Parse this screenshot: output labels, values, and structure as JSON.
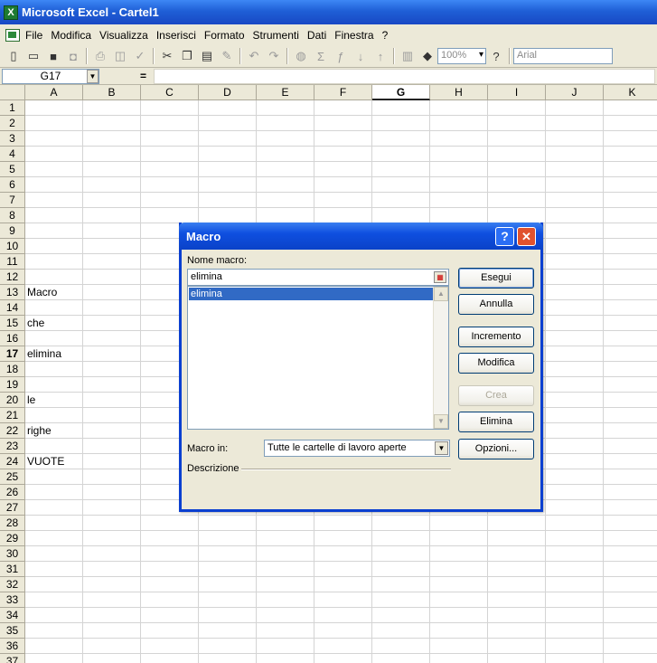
{
  "window": {
    "title": "Microsoft Excel - Cartel1"
  },
  "menu": [
    "File",
    "Modifica",
    "Visualizza",
    "Inserisci",
    "Formato",
    "Strumenti",
    "Dati",
    "Finestra",
    "?"
  ],
  "toolbar": {
    "zoom": "100%",
    "font": "Arial"
  },
  "formula_bar": {
    "name_box": "G17",
    "eq": "="
  },
  "columns": [
    "A",
    "B",
    "C",
    "D",
    "E",
    "F",
    "G",
    "H",
    "I",
    "J",
    "K"
  ],
  "selected_column": "G",
  "selected_row": "17",
  "rows": [
    "1",
    "2",
    "3",
    "4",
    "5",
    "6",
    "7",
    "8",
    "9",
    "10",
    "11",
    "12",
    "13",
    "14",
    "15",
    "16",
    "17",
    "18",
    "19",
    "20",
    "21",
    "22",
    "23",
    "24",
    "25",
    "26",
    "27",
    "28",
    "29",
    "30",
    "31",
    "32",
    "33",
    "34",
    "35",
    "36",
    "37"
  ],
  "cells": {
    "a13": "Macro",
    "a15": "che",
    "a17": "elimina",
    "a20": "le",
    "a22": "righe",
    "a24": "VUOTE"
  },
  "dialog": {
    "title": "Macro",
    "help": "?",
    "close": "✕",
    "name_label": "Nome macro:",
    "name_value": "elimina",
    "list": [
      "elimina"
    ],
    "buttons": {
      "run": "Esegui",
      "cancel": "Annulla",
      "step": "Incremento",
      "edit": "Modifica",
      "create": "Crea",
      "delete": "Elimina",
      "options": "Opzioni..."
    },
    "macro_in_label": "Macro in:",
    "macro_in_value": "Tutte le cartelle di lavoro aperte",
    "description_label": "Descrizione"
  }
}
